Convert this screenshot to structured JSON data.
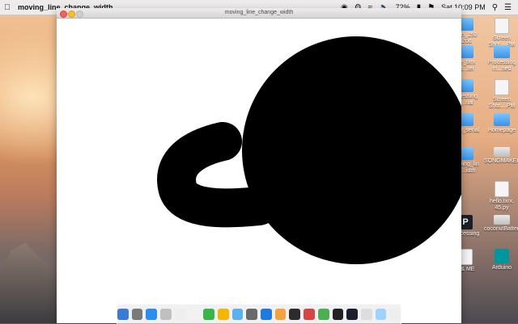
{
  "menubar": {
    "app_name": "moving_line_change_width",
    "battery": "72%",
    "clock": "Sat 10:09 PM"
  },
  "window": {
    "title": "moving_line_change_width"
  },
  "desktop_icons": [
    {
      "label": "etch_150 620d",
      "kind": "folder"
    },
    {
      "label": "Screen Shot....PM",
      "kind": "doc"
    },
    {
      "label": "ple_txrx od...ter",
      "kind": "folder"
    },
    {
      "label": "Processing m...sed",
      "kind": "folder"
    },
    {
      "label": "rocessing e...rial",
      "kind": "folder"
    },
    {
      "label": "Screen Shot....PM",
      "kind": "doc"
    },
    {
      "label": "thon_serial",
      "kind": "folder"
    },
    {
      "label": "Homepage",
      "kind": "folder"
    },
    {
      "label": "moving_lin ch...idth",
      "kind": "folder"
    },
    {
      "label": "SONGMAKER",
      "kind": "drive"
    },
    {
      "label": "hello.txrx. 45.py",
      "kind": "doc"
    },
    {
      "label": "Processing",
      "kind": "proc"
    },
    {
      "label": "coconutBattery",
      "kind": "app"
    },
    {
      "label": "o & ME",
      "kind": "doc"
    },
    {
      "label": "Arduino",
      "kind": "ard"
    }
  ],
  "colors": {
    "canvas_bg": "#ffffff",
    "shape_fill": "#000000"
  }
}
